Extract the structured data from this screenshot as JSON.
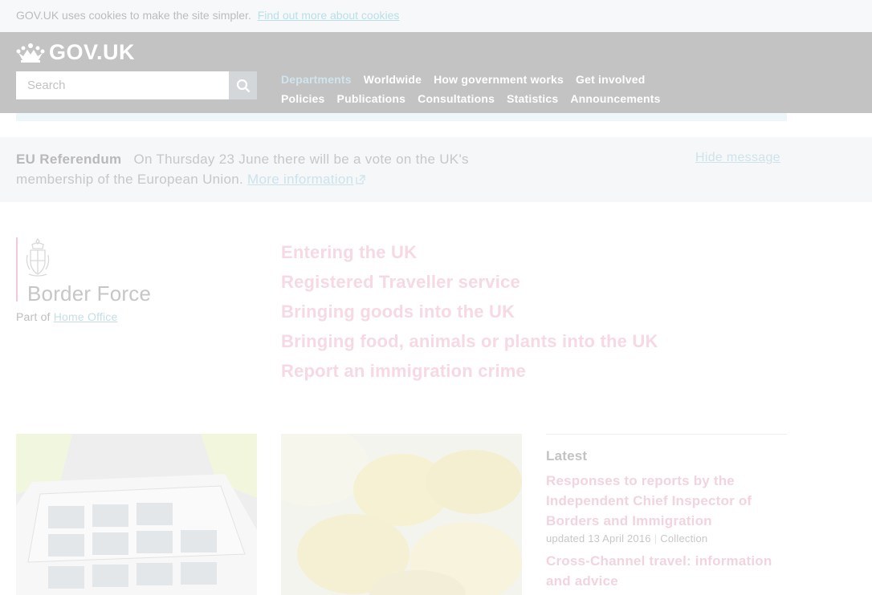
{
  "cookie_banner": {
    "text": "GOV.UK uses cookies to make the site simpler.",
    "link": "Find out more about cookies"
  },
  "header": {
    "logo_text": "GOV.UK",
    "search_placeholder": "Search",
    "nav_row1": [
      "Departments",
      "Worldwide",
      "How government works",
      "Get involved"
    ],
    "nav_row2": [
      "Policies",
      "Publications",
      "Consultations",
      "Statistics",
      "Announcements"
    ]
  },
  "eu_banner": {
    "title": "EU Referendum",
    "text": "On Thursday 23 June there will be a vote on the UK's membership of the European Union.",
    "link": "More information",
    "hide": "Hide message"
  },
  "organisation": {
    "name": "Border Force",
    "part_of_label": "Part of",
    "parent": "Home Office"
  },
  "featured_links": [
    "Entering the UK",
    "Registered Traveller service",
    "Bringing goods into the UK",
    "Bringing food, animals or plants into the UK",
    "Report an immigration crime"
  ],
  "latest": {
    "title": "Latest",
    "items": [
      {
        "title": "Responses to reports by the Independent Chief Inspector of Borders and Immigration",
        "date": "updated 13 April 2016",
        "type": "Collection"
      },
      {
        "title": "Cross-Channel travel: information and advice",
        "date": "",
        "type": ""
      }
    ]
  },
  "colors": {
    "header_bg": "#c3c3c3",
    "link_pink": "#f6d9e3",
    "link_blue": "#cce3eb"
  }
}
